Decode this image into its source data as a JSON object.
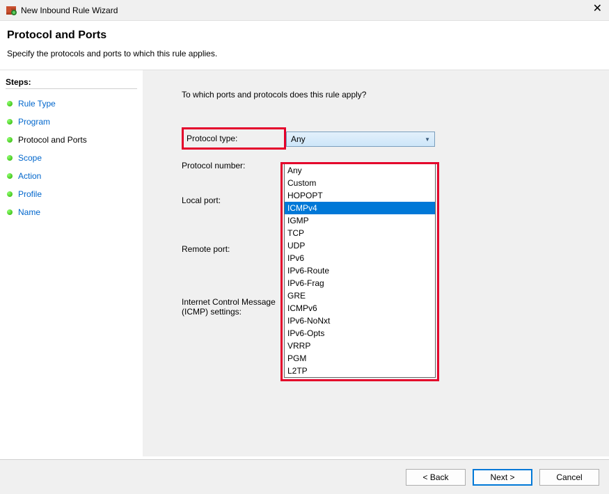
{
  "window": {
    "title": "New Inbound Rule Wizard"
  },
  "header": {
    "heading": "Protocol and Ports",
    "subtext": "Specify the protocols and ports to which this rule applies."
  },
  "sidebar": {
    "title": "Steps:",
    "items": [
      {
        "label": "Rule Type",
        "current": false
      },
      {
        "label": "Program",
        "current": false
      },
      {
        "label": "Protocol and Ports",
        "current": true
      },
      {
        "label": "Scope",
        "current": false
      },
      {
        "label": "Action",
        "current": false
      },
      {
        "label": "Profile",
        "current": false
      },
      {
        "label": "Name",
        "current": false
      }
    ]
  },
  "main": {
    "intro": "To which ports and protocols does this rule apply?",
    "labels": {
      "protocol_type": "Protocol type:",
      "protocol_number": "Protocol number:",
      "local_port": "Local port:",
      "remote_port": "Remote port:",
      "icmp_line1": "Internet Control Message",
      "icmp_line2": "(ICMP) settings:"
    },
    "protocol_select": {
      "value": "Any",
      "highlighted_option": "ICMPv4",
      "options": [
        "Any",
        "Custom",
        "HOPOPT",
        "ICMPv4",
        "IGMP",
        "TCP",
        "UDP",
        "IPv6",
        "IPv6-Route",
        "IPv6-Frag",
        "GRE",
        "ICMPv6",
        "IPv6-NoNxt",
        "IPv6-Opts",
        "VRRP",
        "PGM",
        "L2TP"
      ]
    }
  },
  "footer": {
    "back": "< Back",
    "next": "Next >",
    "cancel": "Cancel"
  }
}
